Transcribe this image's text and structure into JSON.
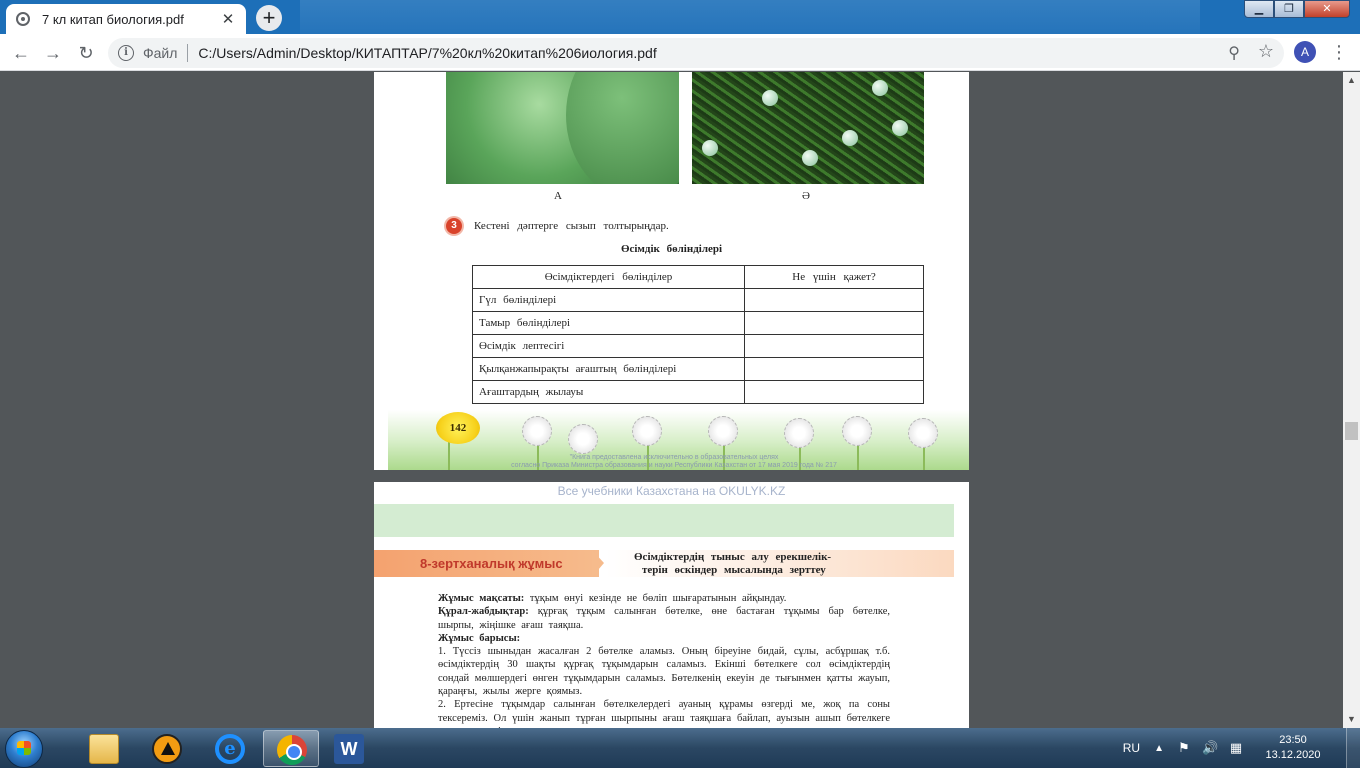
{
  "browser": {
    "tab_title": "7 кл китап биология.pdf",
    "tab_close": "✕",
    "new_tab": "+",
    "scheme_label": "Файл",
    "url": "C:/Users/Admin/Desktop/КИТАПТАР/7%20кл%20китап%206иология.pdf",
    "profile_initial": "A",
    "window_buttons": {
      "minimize": "▁",
      "maximize": "❐",
      "close": "✕"
    }
  },
  "page1": {
    "captions": [
      "A",
      "Ә"
    ],
    "task_number": "3",
    "task_text": "Кестені дəптерге сызып толтырыңдар.",
    "table_title": "Өсімдік бөліндiлерi",
    "table": {
      "headers": [
        "Өсімдіктердегі бөліндiлер",
        "Не үшін қажет?"
      ],
      "rows": [
        [
          "Гүл бөліндiлерi",
          ""
        ],
        [
          "Тамыр бөліндiлерi",
          ""
        ],
        [
          "Өсімдік лептесiгi",
          ""
        ],
        [
          "Қылқанжапырақты ағаштың бөліндiлерi",
          ""
        ],
        [
          "Ағаштардың жылауы",
          ""
        ]
      ]
    },
    "page_number": "142",
    "footnote_line1": "\"Книга предоставлена исключительно в образовательных целях",
    "footnote_line2": "согласно Приказа Министра образования и науки Республики Казахстан от 17 мая 2019 года № 217"
  },
  "page2": {
    "watermark": "Все учебники Казахстана на OKULYK.KZ",
    "lab_label": "8-зертханалық жұмыс",
    "lab_title_line1": "Өсімдіктердің тыныс алу ерекшелік-",
    "lab_title_line2": "терін өскіндер мысалында зерттеу",
    "goal_label": "Жұмыс мақсаты:",
    "goal_text": "тұқым өнуі кезінде не бөліп шығаратынын айқындау.",
    "equipment_label": "Құрал-жабдықтар:",
    "equipment_text": "құрғақ тұқым салынған бөтелке, өне бастаған тұқымы бар бөтелке, шырпы, жіңішке ағаш таяқша.",
    "procedure_label": "Жұмыс барысы:",
    "step1": "1. Түссіз шыныдан жасалған 2 бөтелке аламыз. Оның біреуіне бидай, сұлы, асбұршақ т.б. өсімдіктердің 30 шақты құрғақ тұқымдарын саламыз. Екінші бөтелкеге сол өсімдіктердің сондай мөлшердегі өнген тұқымдарын саламыз. Бөтелкенің екеуін де тығынмен қатты жауып, қараңғы, жылы жерге қоямыз.",
    "step2": "2. Ертесіне тұқымдар салынған бөтелкелердегі ауаның құрамы өзгерді ме, жоқ па соны тексереміз. Ол үшін жанып тұрған шырпыны ағаш таяқшаға байлап, ауызын ашып бөтелкеге салып көреміз."
  },
  "taskbar": {
    "lang": "RU",
    "time": "23:50",
    "date": "13.12.2020"
  }
}
